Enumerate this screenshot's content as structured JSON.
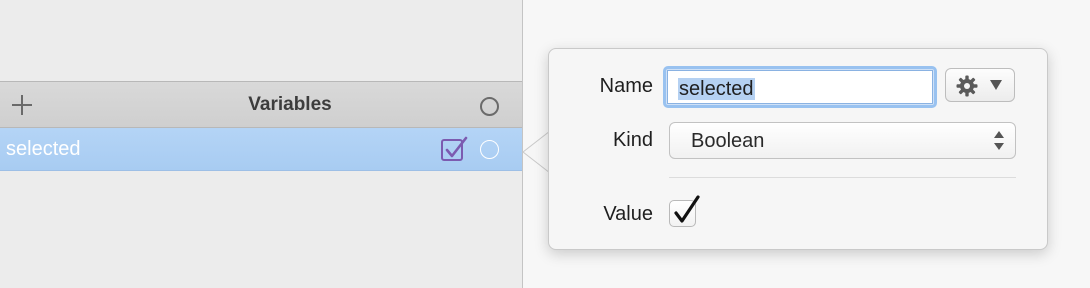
{
  "variables_panel": {
    "title": "Variables",
    "rows": [
      {
        "name": "selected",
        "checked": true
      }
    ]
  },
  "popover": {
    "name_label": "Name",
    "name_value": "selected",
    "kind_label": "Kind",
    "kind_value": "Boolean",
    "value_label": "Value",
    "value_checked": true
  },
  "icons": {
    "add": "plus-icon",
    "gear": "gear-icon",
    "header_circle": "circle-icon",
    "row_check": "checkbox-checked-icon",
    "row_circle": "circle-icon"
  },
  "colors": {
    "selection_row": "#a8ccf2",
    "focus_ring": "#99c2f0",
    "checkbox_purple": "#7c5bb0"
  }
}
